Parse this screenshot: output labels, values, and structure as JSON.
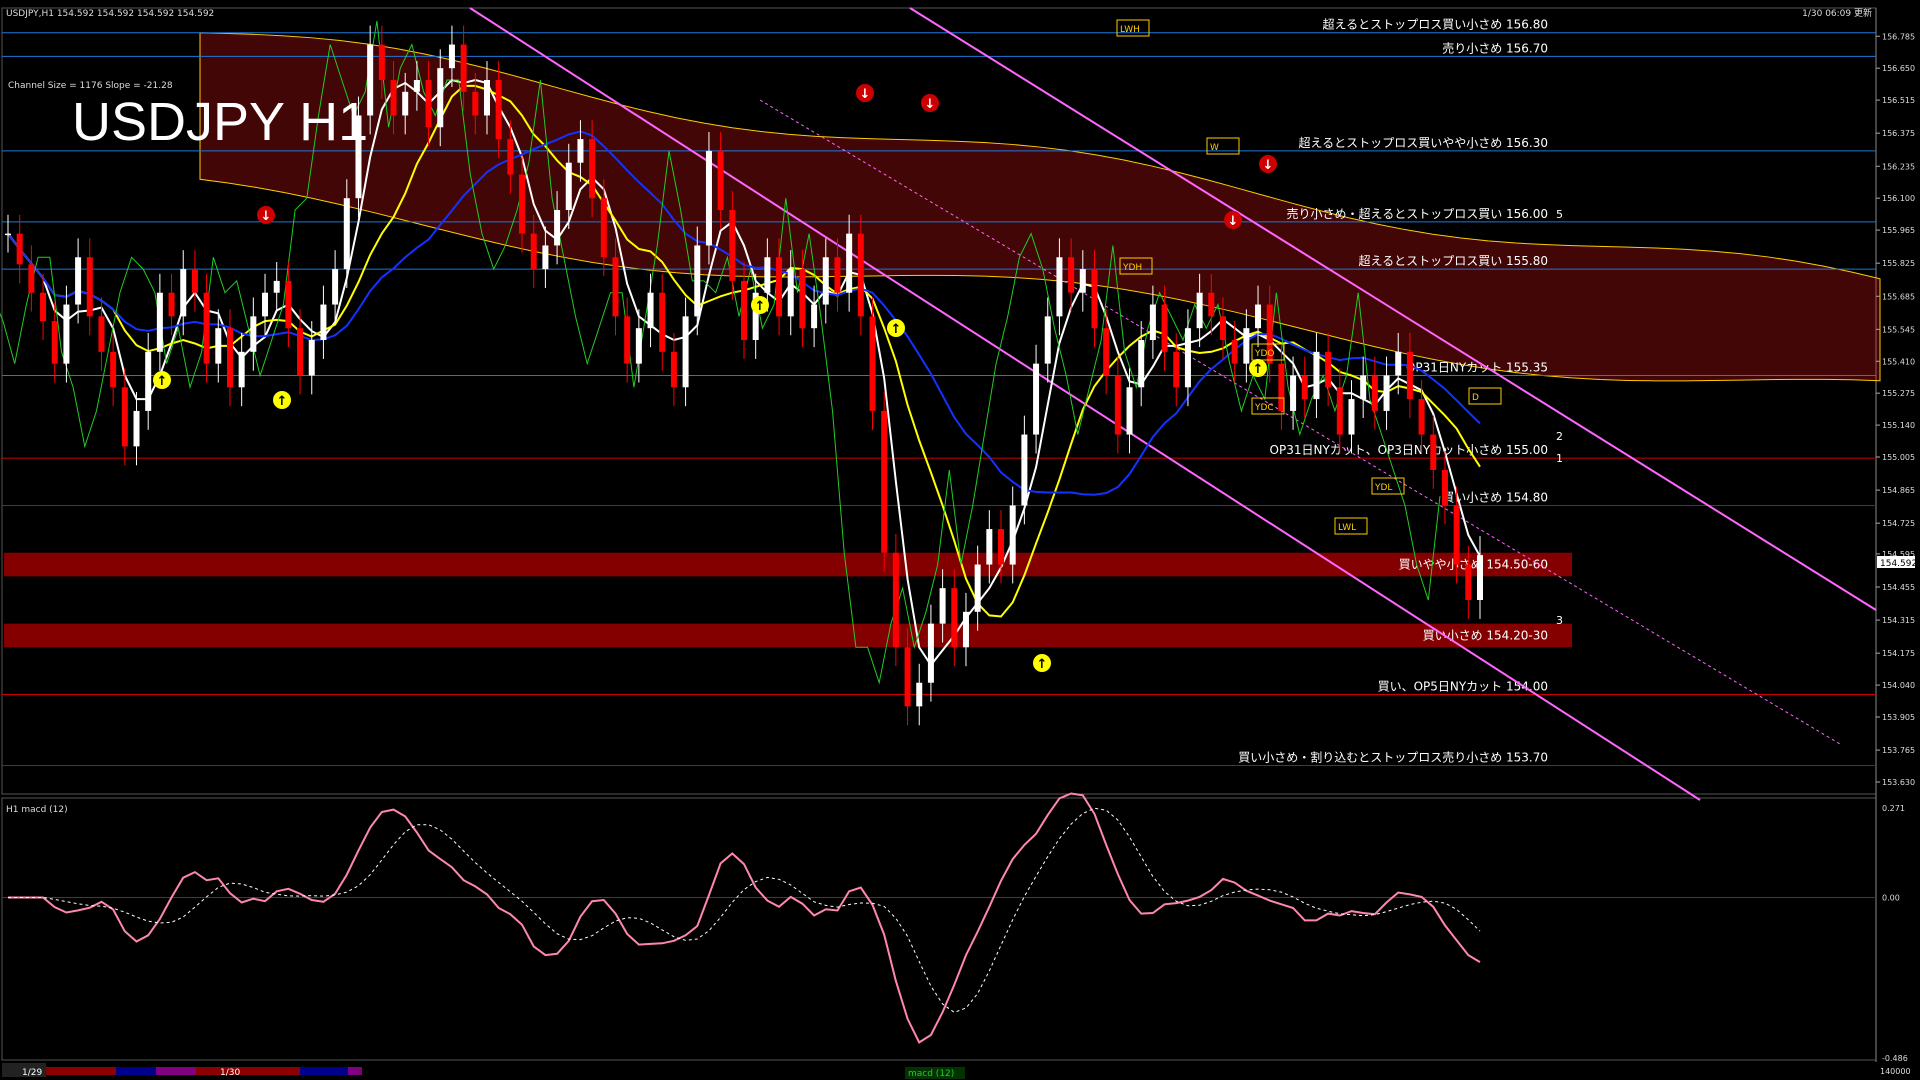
{
  "header": {
    "symbol_line": "USDJPY,H1  154.592 154.592 154.592 154.592",
    "timestamp": "1/30 06:09 更新",
    "channel_info": "Channel Size = 1176  Slope = -21.28",
    "big_title": "USDJPY H1"
  },
  "macd_header": "H1  macd (12)",
  "colors": {
    "bull_candle": "#ffffff",
    "bear_candle": "#ff0000",
    "level_line": "#cc0000",
    "blue_level": "#1e78dc",
    "channel": "#ff66ff",
    "ma_white": "#ffffff",
    "ma_yellow": "#ffff00",
    "ma_blue": "#1432ff",
    "green_line": "#22cc22",
    "cloud": "#c01010",
    "price_tag_bg": "#ffffff"
  },
  "chart_data": {
    "type": "candlestick",
    "symbol": "USDJPY",
    "timeframe": "H1",
    "ylim": [
      153.63,
      156.82
    ],
    "price_axis_ticks": [
      "156.785",
      "156.650",
      "156.515",
      "156.375",
      "156.235",
      "156.100",
      "155.965",
      "155.825",
      "155.685",
      "155.545",
      "155.410",
      "155.275",
      "155.140",
      "155.005",
      "154.865",
      "154.725",
      "154.595",
      "154.455",
      "154.315",
      "154.175",
      "154.040",
      "153.905",
      "153.765",
      "153.630"
    ],
    "current_price": "154.592",
    "close_path": [
      155.95,
      155.82,
      155.7,
      155.58,
      155.4,
      155.65,
      155.85,
      155.6,
      155.45,
      155.3,
      155.05,
      155.2,
      155.45,
      155.7,
      155.6,
      155.8,
      155.7,
      155.4,
      155.55,
      155.3,
      155.45,
      155.6,
      155.7,
      155.75,
      155.55,
      155.35,
      155.5,
      155.65,
      155.8,
      156.1,
      156.45,
      156.75,
      156.6,
      156.45,
      156.55,
      156.6,
      156.4,
      156.65,
      156.75,
      156.55,
      156.45,
      156.6,
      156.35,
      156.2,
      155.95,
      155.8,
      155.9,
      156.05,
      156.25,
      156.35,
      156.1,
      155.85,
      155.6,
      155.4,
      155.55,
      155.7,
      155.45,
      155.3,
      155.6,
      155.9,
      156.3,
      156.05,
      155.75,
      155.5,
      155.7,
      155.85,
      155.6,
      155.8,
      155.55,
      155.65,
      155.85,
      155.7,
      155.95,
      155.6,
      155.2,
      154.6,
      154.2,
      153.95,
      154.05,
      154.3,
      154.45,
      154.2,
      154.35,
      154.55,
      154.7,
      154.55,
      154.8,
      155.1,
      155.4,
      155.6,
      155.85,
      155.7,
      155.8,
      155.55,
      155.35,
      155.1,
      155.3,
      155.5,
      155.65,
      155.45,
      155.3,
      155.55,
      155.7,
      155.6,
      155.5,
      155.4,
      155.55,
      155.65,
      155.4,
      155.2,
      155.35,
      155.25,
      155.45,
      155.3,
      155.1,
      155.25,
      155.35,
      155.2,
      155.35,
      155.45,
      155.25,
      155.1,
      154.95,
      154.8,
      154.55,
      154.4,
      154.59
    ],
    "levels": [
      {
        "price": 156.8,
        "label": "超えるとストップロス買い小さめ 156.80",
        "color": "#1e78dc"
      },
      {
        "price": 156.7,
        "label": "売り小さめ 156.70",
        "color": "#1e78dc"
      },
      {
        "price": 156.3,
        "label": "超えるとストップロス買いやや小さめ 156.30",
        "color": "#1e78dc"
      },
      {
        "price": 156.0,
        "label": "売り小さめ・超えるとストップロス買い 156.00",
        "color": "#1e78dc"
      },
      {
        "price": 155.8,
        "label": "超えるとストップロス買い 155.80",
        "color": "#1e78dc"
      },
      {
        "price": 155.35,
        "label": "OP31日NYカット 155.35",
        "color": "#1e78dc"
      },
      {
        "price": 155.0,
        "label": "OP31日NYカット、OP3日NYカット小さめ 155.00",
        "color": "#cc0000"
      },
      {
        "price": 154.8,
        "label": "買い小さめ 154.80",
        "color": "#cc0000"
      },
      {
        "price": 154.0,
        "label": "買い、OP5日NYカット 154.00",
        "color": "#cc0000"
      },
      {
        "price": 153.7,
        "label": "買い小さめ・割り込むとストップロス売り小さめ 153.70",
        "color": "#cc0000"
      }
    ],
    "zones": [
      {
        "low": 154.5,
        "high": 154.6,
        "label": "買いやや小さめ 154.50-60"
      },
      {
        "low": 154.2,
        "high": 154.3,
        "label": "買い小さめ 154.20-30"
      }
    ],
    "box_labels": [
      "LWH",
      "W",
      "YDH",
      "YDO",
      "YDC",
      "YDL",
      "LWL",
      "D"
    ],
    "wave_labels": [
      "5",
      "2",
      "1",
      "3"
    ],
    "date_labels": [
      "1/29",
      "1/30"
    ],
    "macd": {
      "ylim": [
        -0.486,
        0.271
      ],
      "ticks": [
        "0.271",
        "0.00",
        "-0.486"
      ]
    },
    "footer_label": "macd (12)",
    "bottom_axis_value": "140000"
  }
}
